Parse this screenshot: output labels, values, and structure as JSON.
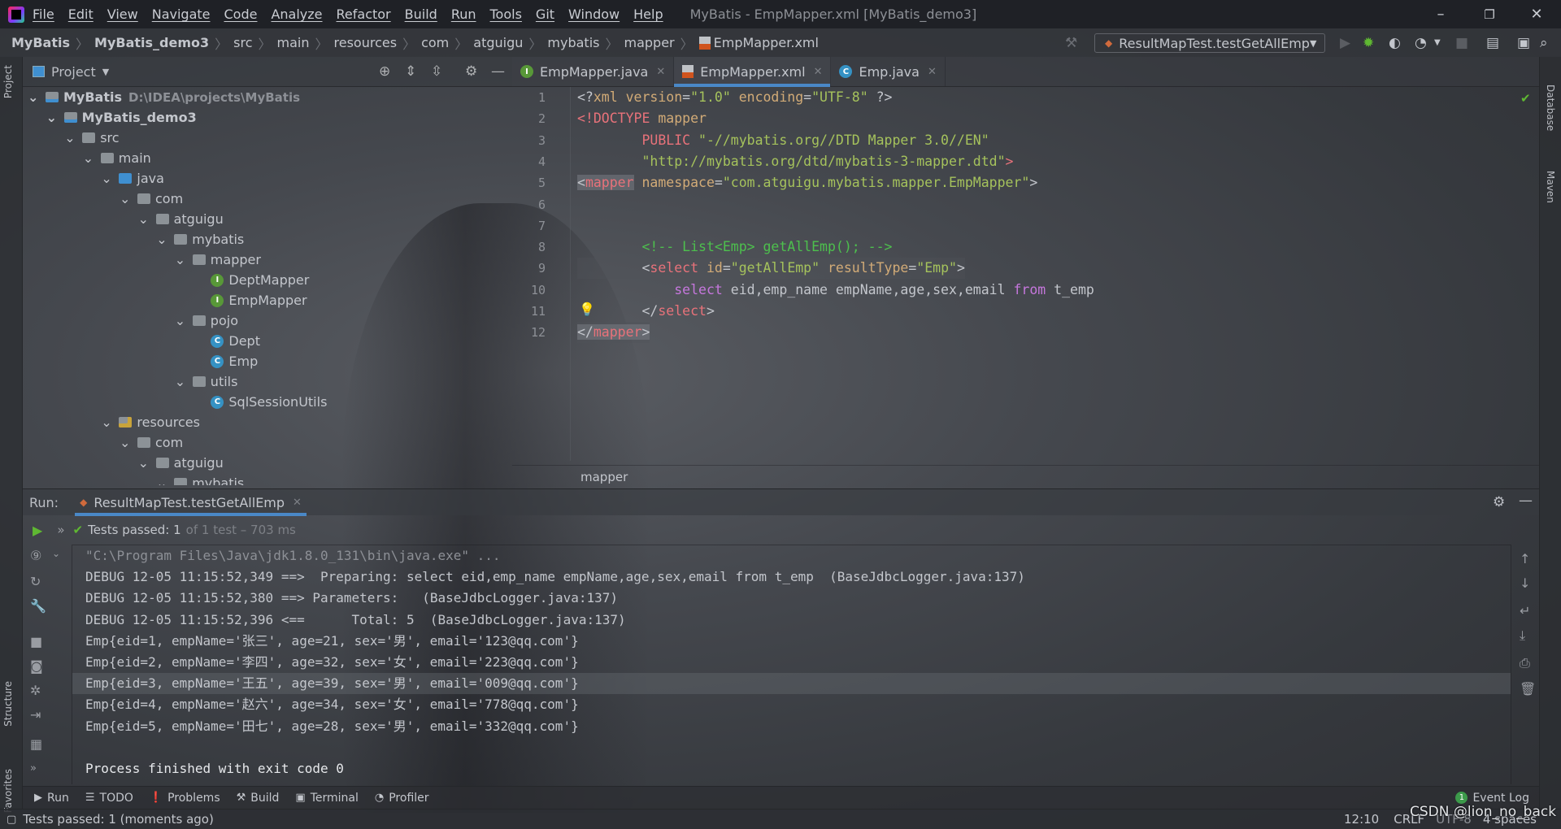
{
  "titlebar": {
    "menus": [
      "File",
      "Edit",
      "View",
      "Navigate",
      "Code",
      "Analyze",
      "Refactor",
      "Build",
      "Run",
      "Tools",
      "Git",
      "Window",
      "Help"
    ],
    "title": "MyBatis - EmpMapper.xml [MyBatis_demo3]",
    "minimize": "–",
    "restore": "❐",
    "close": "✕"
  },
  "navbar": {
    "breadcrumbs": [
      "MyBatis",
      "MyBatis_demo3",
      "src",
      "main",
      "resources",
      "com",
      "atguigu",
      "mybatis",
      "mapper",
      "EmpMapper.xml"
    ],
    "run_config": "ResultMapTest.testGetAllEmp"
  },
  "left_stripe": {
    "project": "Project",
    "structure": "Structure",
    "favorites": "Favorites"
  },
  "right_stripe": {
    "database": "Database",
    "maven": "Maven"
  },
  "project_panel": {
    "title": "Project",
    "tree": [
      {
        "label": "MyBatis",
        "path": "D:\\IDEA\\projects\\MyBatis",
        "level": 0,
        "icon": "folder-module",
        "expanded": true,
        "bold": true
      },
      {
        "label": "MyBatis_demo3",
        "level": 1,
        "icon": "folder-module",
        "expanded": true,
        "bold": true
      },
      {
        "label": "src",
        "level": 2,
        "icon": "folder",
        "expanded": true
      },
      {
        "label": "main",
        "level": 3,
        "icon": "folder",
        "expanded": true
      },
      {
        "label": "java",
        "level": 4,
        "icon": "folder-source",
        "expanded": true
      },
      {
        "label": "com",
        "level": 5,
        "icon": "folder",
        "expanded": true
      },
      {
        "label": "atguigu",
        "level": 6,
        "icon": "folder",
        "expanded": true
      },
      {
        "label": "mybatis",
        "level": 7,
        "icon": "folder",
        "expanded": true
      },
      {
        "label": "mapper",
        "level": 8,
        "icon": "folder",
        "expanded": true
      },
      {
        "label": "DeptMapper",
        "level": 9,
        "icon": "interface"
      },
      {
        "label": "EmpMapper",
        "level": 9,
        "icon": "interface"
      },
      {
        "label": "pojo",
        "level": 8,
        "icon": "folder",
        "expanded": true
      },
      {
        "label": "Dept",
        "level": 9,
        "icon": "class"
      },
      {
        "label": "Emp",
        "level": 9,
        "icon": "class"
      },
      {
        "label": "utils",
        "level": 8,
        "icon": "folder",
        "expanded": true
      },
      {
        "label": "SqlSessionUtils",
        "level": 9,
        "icon": "class"
      },
      {
        "label": "resources",
        "level": 4,
        "icon": "folder-resources",
        "expanded": true
      },
      {
        "label": "com",
        "level": 5,
        "icon": "folder",
        "expanded": true
      },
      {
        "label": "atguigu",
        "level": 6,
        "icon": "folder",
        "expanded": true
      },
      {
        "label": "mybatis",
        "level": 7,
        "icon": "folder",
        "expanded": true
      }
    ]
  },
  "editor": {
    "tabs": [
      {
        "label": "EmpMapper.java",
        "icon": "interface",
        "active": false
      },
      {
        "label": "EmpMapper.xml",
        "icon": "xml",
        "active": true
      },
      {
        "label": "Emp.java",
        "icon": "class",
        "active": false
      }
    ],
    "lines": [
      [
        {
          "k": "punc",
          "t": "<?"
        },
        {
          "k": "attr",
          "t": "xml version"
        },
        {
          "k": "punc",
          "t": "="
        },
        {
          "k": "str",
          "t": "\"1.0\""
        },
        {
          "k": "attr",
          "t": " encoding"
        },
        {
          "k": "punc",
          "t": "="
        },
        {
          "k": "str",
          "t": "\"UTF-8\""
        },
        {
          "k": "punc",
          "t": " ?>"
        }
      ],
      [
        {
          "k": "tag",
          "t": "<!DOCTYPE"
        },
        {
          "k": "attr",
          "t": " mapper"
        }
      ],
      [
        {
          "k": "txt",
          "t": "        "
        },
        {
          "k": "tag",
          "t": "PUBLIC"
        },
        {
          "k": "str",
          "t": " \"-//mybatis.org//DTD Mapper 3.0//EN\""
        }
      ],
      [
        {
          "k": "txt",
          "t": "        "
        },
        {
          "k": "str",
          "t": "\"http://mybatis.org/dtd/mybatis-3-mapper.dtd\""
        },
        {
          "k": "tag",
          "t": ">"
        }
      ],
      [
        {
          "k": "punc",
          "t": "<",
          "hl": true
        },
        {
          "k": "tag",
          "t": "mapper",
          "hl": true
        },
        {
          "k": "attr",
          "t": " namespace"
        },
        {
          "k": "punc",
          "t": "="
        },
        {
          "k": "str",
          "t": "\"com.atguigu.mybatis.mapper.EmpMapper\""
        },
        {
          "k": "punc",
          "t": ">"
        }
      ],
      [],
      [],
      [
        {
          "k": "txt",
          "t": "        "
        },
        {
          "k": "com",
          "t": "<!-- List<Emp> getAllEmp(); -->"
        }
      ],
      [
        {
          "k": "txt",
          "t": "        "
        },
        {
          "k": "punc",
          "t": "<"
        },
        {
          "k": "tag",
          "t": "select"
        },
        {
          "k": "attr",
          "t": " id"
        },
        {
          "k": "punc",
          "t": "="
        },
        {
          "k": "str",
          "t": "\"getAllEmp\""
        },
        {
          "k": "attr",
          "t": " resultType"
        },
        {
          "k": "punc",
          "t": "="
        },
        {
          "k": "str",
          "t": "\"Emp\""
        },
        {
          "k": "punc",
          "t": ">"
        }
      ],
      [
        {
          "k": "txt",
          "t": "            "
        },
        {
          "k": "kw",
          "t": "select"
        },
        {
          "k": "txt",
          "t": " eid,emp_name empName,age,sex,email "
        },
        {
          "k": "kw",
          "t": "from"
        },
        {
          "k": "txt",
          "t": " t_emp"
        }
      ],
      [
        {
          "k": "txt",
          "t": "        "
        },
        {
          "k": "punc",
          "t": "</"
        },
        {
          "k": "tag",
          "t": "select"
        },
        {
          "k": "punc",
          "t": ">"
        }
      ],
      [
        {
          "k": "punc",
          "t": "</",
          "hl": true
        },
        {
          "k": "tag",
          "t": "mapper",
          "hl": true
        },
        {
          "k": "punc",
          "t": ">",
          "hl": true
        }
      ]
    ],
    "breadcrumb": "mapper"
  },
  "run_panel": {
    "label": "Run:",
    "tab": "ResultMapTest.testGetAllEmp",
    "tests_passed": "Tests passed: 1",
    "tests_detail": "of 1 test – 703 ms",
    "console": [
      {
        "text": "\"C:\\Program Files\\Java\\jdk1.8.0_131\\bin\\java.exe\" ...",
        "kind": "cmd"
      },
      {
        "text": "DEBUG 12-05 11:15:52,349 ==>  Preparing: select eid,emp_name empName,age,sex,email from t_emp  (BaseJdbcLogger.java:137)",
        "kind": "log"
      },
      {
        "text": "DEBUG 12-05 11:15:52,380 ==> Parameters:   (BaseJdbcLogger.java:137)",
        "kind": "log"
      },
      {
        "text": "DEBUG 12-05 11:15:52,396 <==      Total: 5  (BaseJdbcLogger.java:137)",
        "kind": "log"
      },
      {
        "text": "Emp{eid=1, empName='张三', age=21, sex='男', email='123@qq.com'}",
        "kind": "log"
      },
      {
        "text": "Emp{eid=2, empName='李四', age=32, sex='女', email='223@qq.com'}",
        "kind": "log"
      },
      {
        "text": "Emp{eid=3, empName='王五', age=39, sex='男', email='009@qq.com'}",
        "kind": "log"
      },
      {
        "text": "Emp{eid=4, empName='赵六', age=34, sex='女', email='778@qq.com'}",
        "kind": "log"
      },
      {
        "text": "Emp{eid=5, empName='田七', age=28, sex='男', email='332@qq.com'}",
        "kind": "log"
      },
      {
        "text": "",
        "kind": "log"
      },
      {
        "text": "Process finished with exit code 0",
        "kind": "fin"
      }
    ]
  },
  "tool_windows": {
    "items": [
      "Run",
      "TODO",
      "Problems",
      "Build",
      "Terminal",
      "Profiler"
    ],
    "event_log": "Event Log",
    "event_count": "1"
  },
  "status_bar": {
    "message": "Tests passed: 1 (moments ago)",
    "position": "12:10",
    "line_sep": "CRLF",
    "encoding": "UTF-8",
    "indent": "4 spaces"
  },
  "watermark": "CSDN @lion_no_back",
  "colors": {
    "accent": "#4a88c7",
    "pass": "#5fb832",
    "tag": "#e8727a",
    "string": "#a5c25c",
    "comment": "#4dc04d",
    "keyword": "#c677dd"
  }
}
